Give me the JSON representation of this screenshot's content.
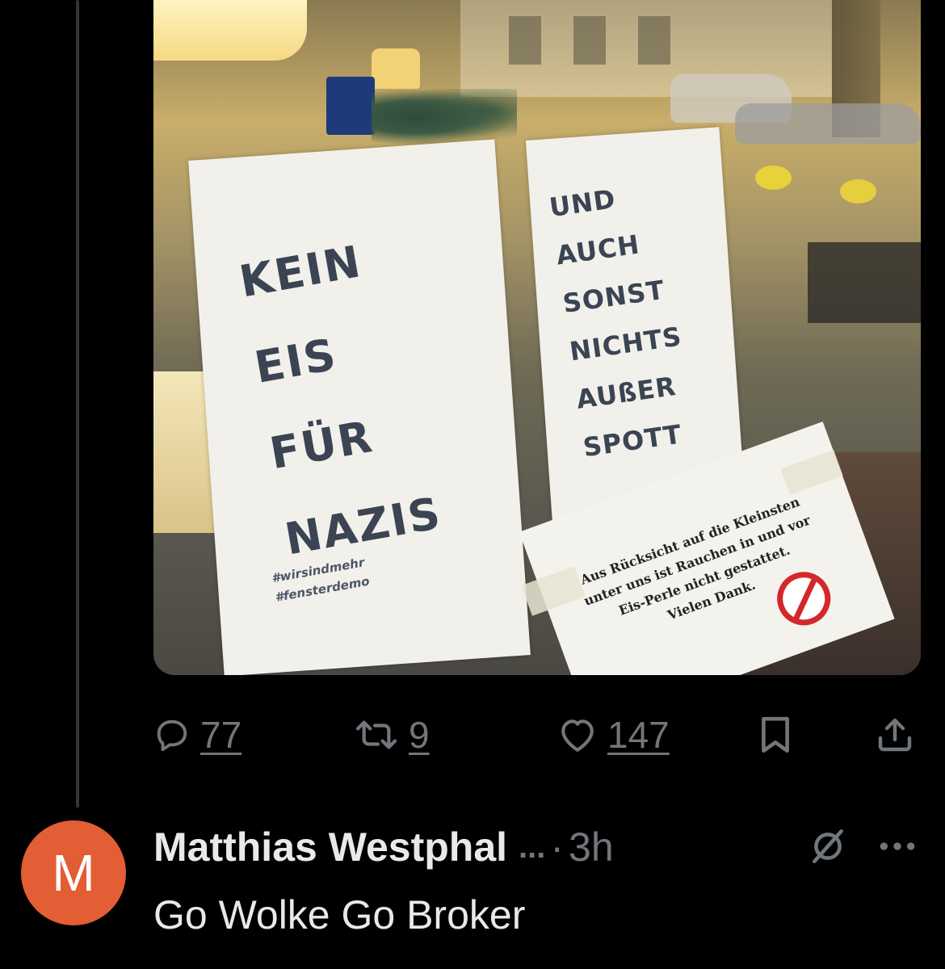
{
  "tweet": {
    "image": {
      "sign_left": {
        "lines": [
          "KEIN",
          "EIS",
          "FÜR",
          "NAZIS"
        ],
        "hashtags": [
          "#wirsindmehr",
          "#fensterdemo"
        ]
      },
      "sign_right": {
        "lines": [
          "UND",
          "AUCH",
          "SONST",
          "NICHTS",
          "AUßER",
          "SPOTT"
        ]
      },
      "notice": {
        "lines": [
          "Aus Rücksicht auf die Kleinsten",
          "unter uns ist Rauchen in und vor",
          "Eis-Perle nicht gestattet.",
          "Vielen Dank."
        ]
      }
    },
    "actions": {
      "replies": "77",
      "retweets": "9",
      "likes": "147"
    }
  },
  "reply": {
    "avatar_letter": "M",
    "avatar_color": "#e35d35",
    "author": "Matthias Westphal",
    "ellipsis": "...",
    "separator": "·",
    "time": "3h",
    "text": "Go Wolke Go Broker"
  },
  "colors": {
    "background": "#000000",
    "text_primary": "#e7e9ea",
    "text_secondary": "#71767b"
  }
}
